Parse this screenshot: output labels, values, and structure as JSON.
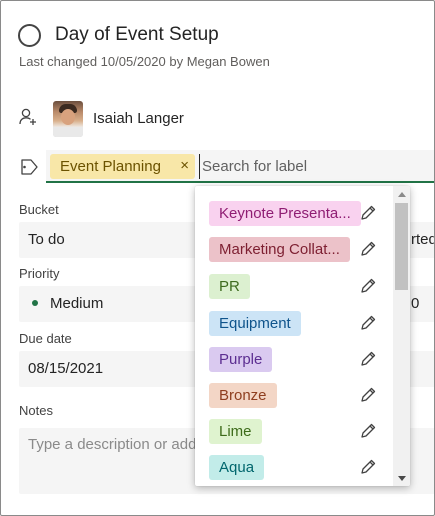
{
  "task": {
    "title": "Day of Event Setup",
    "last_changed": "Last changed 10/05/2020 by Megan Bowen"
  },
  "assignee": {
    "name": "Isaiah Langer"
  },
  "labels": {
    "applied": [
      {
        "text": "Event Planning",
        "bg": "#f8e7a8",
        "fg": "#6b5200"
      }
    ],
    "search_placeholder": "Search for label",
    "remove_glyph": "×",
    "options": [
      {
        "text": "Keynote Presenta...",
        "bg": "#f9d2ef",
        "fg": "#8f1e73"
      },
      {
        "text": "Marketing Collat...",
        "bg": "#ecc2c9",
        "fg": "#7d1f31"
      },
      {
        "text": "PR",
        "bg": "#dcf0d0",
        "fg": "#3e6b1f"
      },
      {
        "text": "Equipment",
        "bg": "#cce4f6",
        "fg": "#0f548c"
      },
      {
        "text": "Purple",
        "bg": "#dacaf0",
        "fg": "#5c2e91"
      },
      {
        "text": "Bronze",
        "bg": "#f3d6c6",
        "fg": "#8e3e1f"
      },
      {
        "text": "Lime",
        "bg": "#dff3cf",
        "fg": "#3d6b1a"
      },
      {
        "text": "Aqua",
        "bg": "#c2ece9",
        "fg": "#00666d"
      }
    ]
  },
  "bucket": {
    "label": "Bucket",
    "value": "To do",
    "peek": "rted"
  },
  "priority": {
    "label": "Priority",
    "value": "Medium",
    "peek": "0"
  },
  "due_date": {
    "label": "Due date",
    "value": "08/15/2021"
  },
  "notes": {
    "label": "Notes",
    "placeholder": "Type a description or add"
  },
  "icons": {
    "status": "circle-icon",
    "assign": "person-add-icon",
    "label": "tag-icon",
    "remove": "close-icon",
    "edit": "pencil-icon",
    "scroll_up": "chevron-up-icon",
    "scroll_down": "chevron-down-icon"
  },
  "colors": {
    "accent": "#217346",
    "field_bg": "#f5f5f5"
  }
}
